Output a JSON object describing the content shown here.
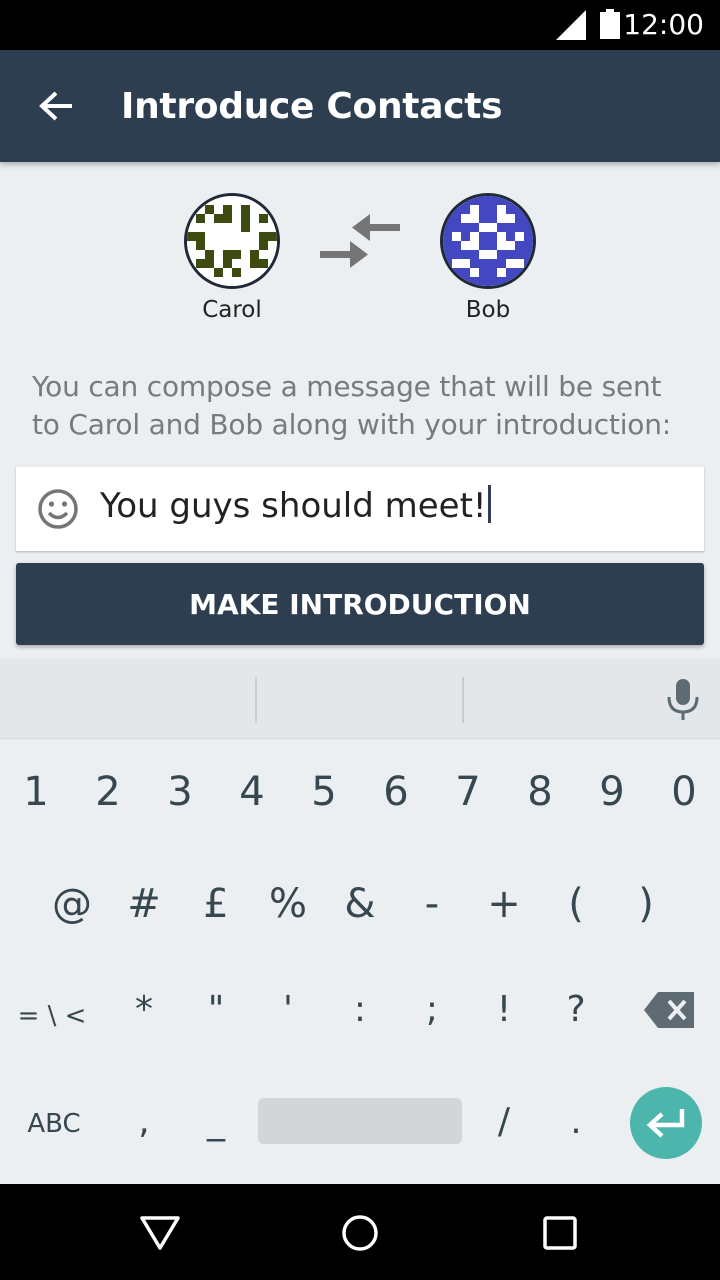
{
  "status_bar": {
    "time": "12:00"
  },
  "app_bar": {
    "title": "Introduce Contacts",
    "back_icon": "arrow-back-icon"
  },
  "contacts": [
    {
      "name": "Carol",
      "avatar_color": "#3d4a10"
    },
    {
      "name": "Bob",
      "avatar_color": "#4347c0"
    }
  ],
  "swap_icon": "swap-arrows-icon",
  "info_text": "You can compose a message that will be sent to Carol and Bob along with your introduction:",
  "message": {
    "value": "You guys should meet!",
    "emoji_icon": "smiley-icon"
  },
  "action_button": {
    "label": "MAKE INTRODUCTION"
  },
  "keyboard": {
    "row1": [
      "1",
      "2",
      "3",
      "4",
      "5",
      "6",
      "7",
      "8",
      "9",
      "0"
    ],
    "row2": [
      "@",
      "#",
      "£",
      "%",
      "&",
      "-",
      "+",
      "(",
      ")"
    ],
    "row3": [
      "= \\ <",
      "*",
      "\"",
      "'",
      ":",
      ";",
      "!",
      "?"
    ],
    "row4": [
      "ABC",
      ",",
      "_",
      "/",
      "."
    ],
    "accent_color": "#4db6ac"
  },
  "colors": {
    "primary": "#2d3e50",
    "background": "#eceff1"
  }
}
